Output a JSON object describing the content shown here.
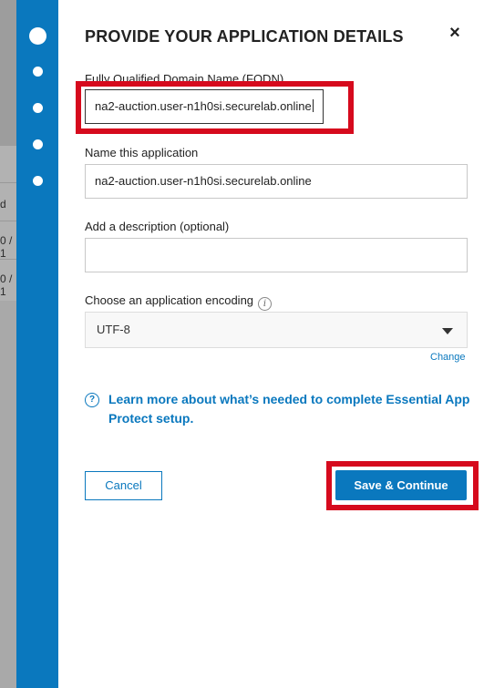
{
  "background": {
    "row_cells": [
      "d",
      "0 / 1",
      "0 / 1"
    ]
  },
  "steps": {
    "count": 5,
    "active_index": 0
  },
  "dialog": {
    "title": "PROVIDE YOUR APPLICATION DETAILS",
    "close_icon": "×",
    "fqdn": {
      "label": "Fully Qualified Domain Name (FQDN)",
      "value": "na2-auction.user-n1h0si.securelab.online"
    },
    "app_name": {
      "label": "Name this application",
      "value": "na2-auction.user-n1h0si.securelab.online"
    },
    "description": {
      "label": "Add a description (optional)",
      "value": ""
    },
    "encoding": {
      "label": "Choose an application encoding",
      "info_icon": "i",
      "selected": "UTF-8",
      "change_label": "Change"
    },
    "help": {
      "icon": "?",
      "text": "Learn more about what’s needed to complete Essential App Protect setup."
    },
    "buttons": {
      "cancel": "Cancel",
      "save": "Save & Continue"
    }
  },
  "colors": {
    "accent": "#0a78be",
    "highlight": "#d60a1d"
  }
}
